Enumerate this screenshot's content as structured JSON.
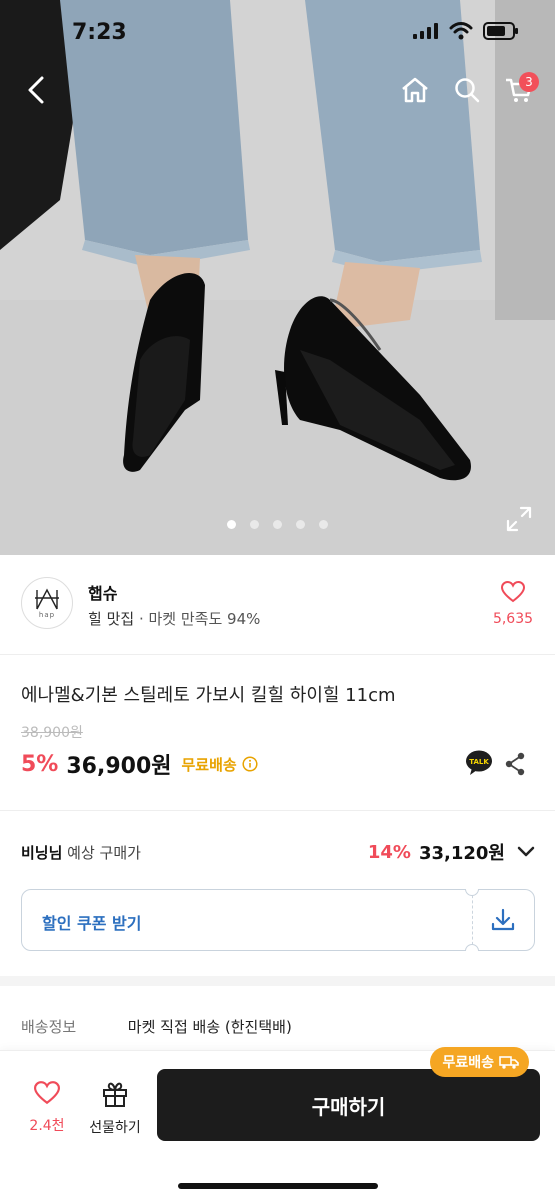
{
  "status": {
    "time": "7:23"
  },
  "nav": {
    "cart_count": "3"
  },
  "gallery": {
    "image_count": 5,
    "active_index": 0
  },
  "seller": {
    "name": "햅슈",
    "category": "힐 맛집",
    "satisfaction": "· 마켓 만족도 94%",
    "likes": "5,635",
    "logo_text": "hap"
  },
  "product": {
    "title": "에나멜&기본  스틸레토 가보시 킬힐 하이힐 11cm",
    "original_price": "38,900원",
    "discount": "5%",
    "price": "36,900원",
    "free_shipping": "무료배송"
  },
  "member": {
    "name": "비닝님",
    "label": " 예상 구매가",
    "discount": "14%",
    "price": "33,120원"
  },
  "coupon": {
    "label": "할인 쿠폰 받기"
  },
  "shipping": {
    "key": "배송정보",
    "value": "마켓 직접 배송 (한진택배)"
  },
  "bottom": {
    "like_count": "2.4천",
    "gift_label": "선물하기",
    "buy_label": "구매하기",
    "ship_tag": "무료배송"
  },
  "colors": {
    "accent_red": "#f04b59",
    "free_ship_yellow": "#e8a300",
    "coupon_blue": "#2c6fbf",
    "buy_button": "#1c1c1c"
  },
  "icons": [
    "back-icon",
    "home-icon",
    "search-icon",
    "cart-icon",
    "expand-icon",
    "heart-icon",
    "info-icon",
    "kakao-talk-icon",
    "share-icon",
    "chevron-down-icon",
    "download-icon",
    "gift-icon",
    "truck-icon"
  ]
}
